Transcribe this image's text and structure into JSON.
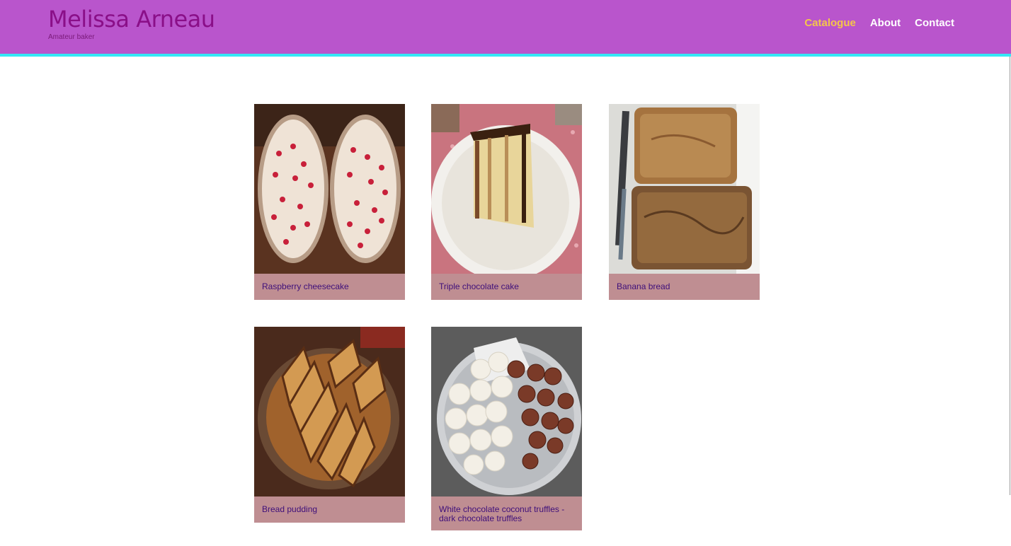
{
  "header": {
    "title": "Melissa Arneau",
    "subtitle": "Amateur baker",
    "accent_color": "#b955cc",
    "underline_color": "#35e7f5"
  },
  "nav": {
    "items": [
      {
        "label": "Catalogue",
        "active": true
      },
      {
        "label": "About",
        "active": false
      },
      {
        "label": "Contact",
        "active": false
      }
    ]
  },
  "catalogue": {
    "caption_bg": "#bf8e92",
    "caption_color": "#3e0f7a",
    "items": [
      {
        "caption": "Raspberry cheesecake",
        "icon": "cheesecake-photo"
      },
      {
        "caption": "Triple chocolate cake",
        "icon": "chocolate-cake-photo"
      },
      {
        "caption": "Banana bread",
        "icon": "banana-bread-photo"
      },
      {
        "caption": "Bread pudding",
        "icon": "bread-pudding-photo"
      },
      {
        "caption": "White chocolate coconut truffles - dark chocolate truffles",
        "icon": "truffles-photo"
      }
    ]
  }
}
